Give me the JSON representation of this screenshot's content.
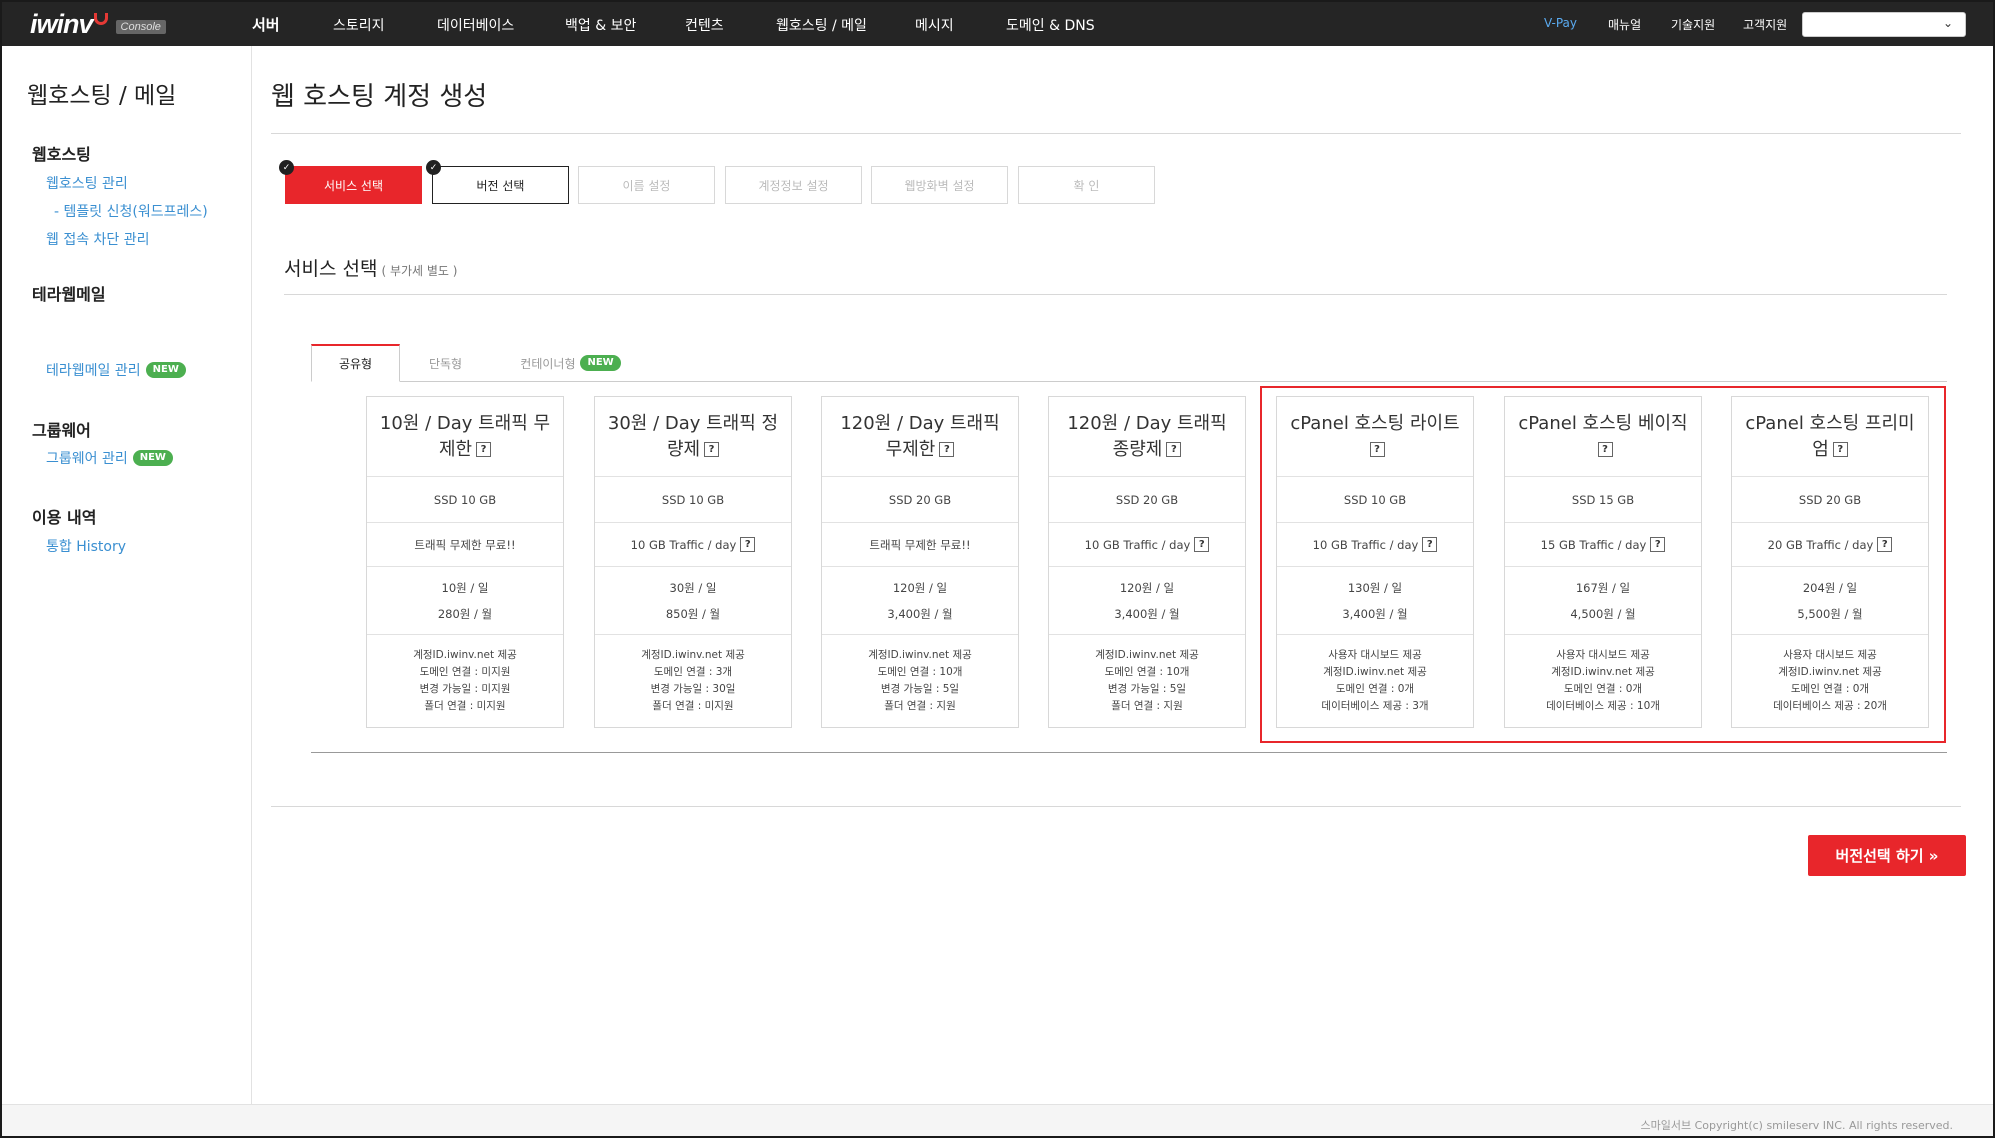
{
  "nav": {
    "logo": "iwinv",
    "logo_badge": "Console",
    "menu": [
      "서버",
      "스토리지",
      "데이터베이스",
      "백업 & 보안",
      "컨텐츠",
      "웹호스팅 / 메일",
      "메시지",
      "도메인 & DNS"
    ],
    "right_links": [
      "V-Pay",
      "매뉴얼",
      "기술지원",
      "고객지원"
    ],
    "select_value": ""
  },
  "sidebar": {
    "title": "웹호스팅 / 메일",
    "sections": [
      {
        "title": "웹호스팅",
        "items": [
          {
            "label": "웹호스팅 관리"
          },
          {
            "label": "- 템플릿 신청(워드프레스)"
          },
          {
            "label": "웹 접속 차단 관리"
          }
        ]
      },
      {
        "title": "테라웹메일",
        "items": [
          {
            "label": "테라웹메일 관리",
            "badge": "NEW"
          }
        ]
      },
      {
        "title": "그룹웨어",
        "items": [
          {
            "label": "그룹웨어 관리",
            "badge": "NEW"
          }
        ]
      },
      {
        "title": "이용 내역",
        "items": [
          {
            "label": "통합 History"
          }
        ]
      }
    ]
  },
  "page": {
    "title": "웹 호스팅 계정 생성",
    "steps": [
      "서비스 선택",
      "버전 선택",
      "이름 설정",
      "계정정보 설정",
      "웹방화벽 설정",
      "확 인"
    ],
    "section_title": "서비스 선택",
    "section_note": "( 부가세 별도 )",
    "tabs": [
      {
        "label": "공유형"
      },
      {
        "label": "단독형"
      },
      {
        "label": "컨테이너형",
        "badge": "NEW"
      }
    ],
    "next_button": "버전선택 하기 »"
  },
  "plans": [
    {
      "title": "10원 / Day 트래픽 무제한",
      "ssd": "SSD 10 GB",
      "traffic": "트래픽 무제한 무료!!",
      "traffic_help": false,
      "price_day": "10원 / 일",
      "price_month": "280원 / 월",
      "features": [
        "계정ID.iwinv.net 제공",
        "도메인 연결 : 미지원",
        "변경 가능일 : 미지원",
        "폴더 연결 : 미지원"
      ]
    },
    {
      "title": "30원 / Day 트래픽 정량제",
      "ssd": "SSD 10 GB",
      "traffic": "10 GB Traffic / day",
      "traffic_help": true,
      "price_day": "30원 / 일",
      "price_month": "850원 / 월",
      "features": [
        "계정ID.iwinv.net 제공",
        "도메인 연결 : 3개",
        "변경 가능일 : 30일",
        "폴더 연결 : 미지원"
      ]
    },
    {
      "title": "120원 / Day 트래픽 무제한",
      "ssd": "SSD 20 GB",
      "traffic": "트래픽 무제한 무료!!",
      "traffic_help": false,
      "price_day": "120원 / 일",
      "price_month": "3,400원 / 월",
      "features": [
        "계정ID.iwinv.net 제공",
        "도메인 연결 : 10개",
        "변경 가능일 : 5일",
        "폴더 연결 : 지원"
      ]
    },
    {
      "title": "120원 / Day 트래픽 종량제",
      "ssd": "SSD 20 GB",
      "traffic": "10 GB Traffic / day",
      "traffic_help": true,
      "price_day": "120원 / 일",
      "price_month": "3,400원 / 월",
      "features": [
        "계정ID.iwinv.net 제공",
        "도메인 연결 : 10개",
        "변경 가능일 : 5일",
        "폴더 연결 : 지원"
      ]
    },
    {
      "title": "cPanel 호스팅 라이트",
      "ssd": "SSD 10 GB",
      "traffic": "10 GB Traffic / day",
      "traffic_help": true,
      "price_day": "130원 / 일",
      "price_month": "3,400원 / 월",
      "features": [
        "사용자 대시보드 제공",
        "계정ID.iwinv.net 제공",
        "도메인 연결 : 0개",
        "데이터베이스 제공 : 3개"
      ]
    },
    {
      "title": "cPanel 호스팅 베이직",
      "ssd": "SSD 15 GB",
      "traffic": "15 GB Traffic / day",
      "traffic_help": true,
      "price_day": "167원 / 일",
      "price_month": "4,500원 / 월",
      "features": [
        "사용자 대시보드 제공",
        "계정ID.iwinv.net 제공",
        "도메인 연결 : 0개",
        "데이터베이스 제공 : 10개"
      ]
    },
    {
      "title": "cPanel 호스팅 프리미엄",
      "ssd": "SSD 20 GB",
      "traffic": "20 GB Traffic / day",
      "traffic_help": true,
      "price_day": "204원 / 일",
      "price_month": "5,500원 / 월",
      "features": [
        "사용자 대시보드 제공",
        "계정ID.iwinv.net 제공",
        "도메인 연결 : 0개",
        "데이터베이스 제공 : 20개"
      ]
    }
  ],
  "help_mark": "?",
  "footer": {
    "copyright": "스마일서브 Copyright(c) smileserv INC. All rights reserved."
  },
  "colors": {
    "accent": "#e8262b",
    "link": "#3a8fd1",
    "new_badge": "#4caf50",
    "nav_bg": "#252525"
  }
}
